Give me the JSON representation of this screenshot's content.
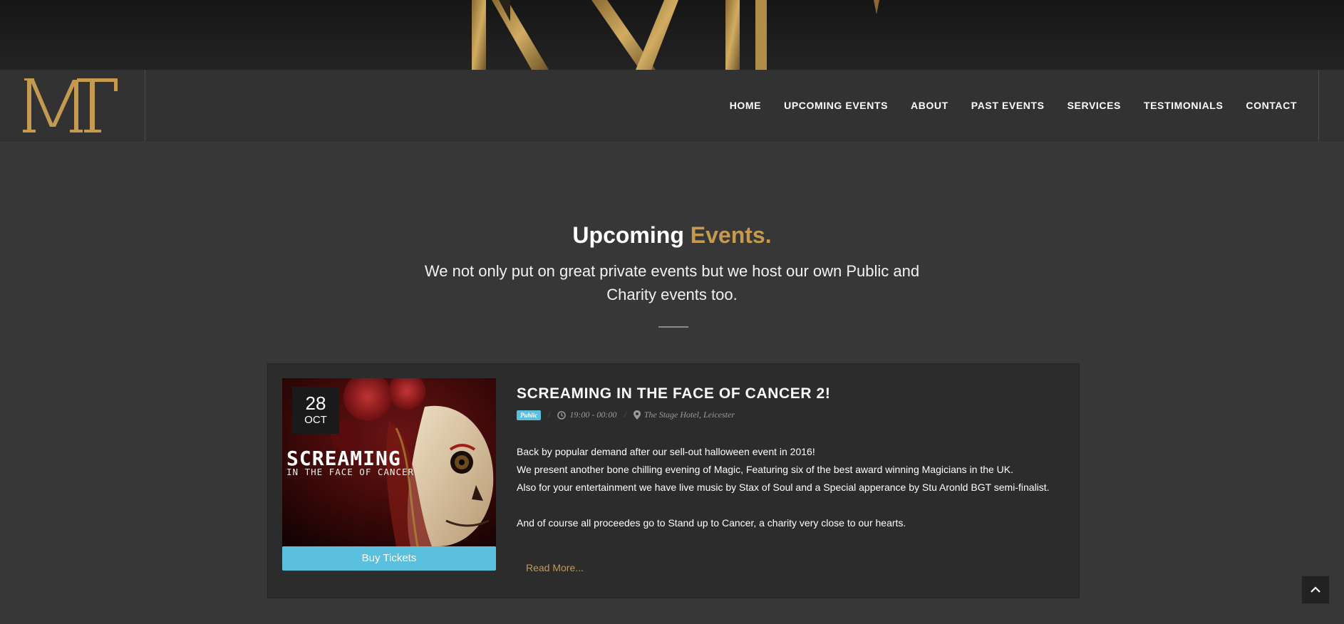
{
  "brand": {
    "logo_text": "MT",
    "accent_color": "#c39a4f"
  },
  "nav": {
    "items": [
      {
        "label": "HOME"
      },
      {
        "label": "UPCOMING EVENTS"
      },
      {
        "label": "ABOUT"
      },
      {
        "label": "PAST EVENTS"
      },
      {
        "label": "SERVICES"
      },
      {
        "label": "TESTIMONIALS"
      },
      {
        "label": "CONTACT"
      }
    ]
  },
  "section": {
    "title_part1": "Upcoming",
    "title_part2": "Events.",
    "subtitle": "We not only put on great private events but we host our own Public and Charity events too."
  },
  "event": {
    "date_day": "28",
    "date_month": "OCT",
    "poster_title": "SCREAMING",
    "poster_subtitle": "IN THE FACE OF CANCER",
    "buy_label": "Buy Tickets",
    "title": "SCREAMING IN THE FACE OF CANCER 2!",
    "tag": "Public",
    "time": "19:00 - 00:00",
    "location": "The Stage Hotel, Leicester",
    "description_lines": [
      "Back by popular demand after our sell-out halloween event in 2016!",
      "We present another bone chilling evening of Magic, Featuring six of the best award winning Magicians in the UK.",
      "Also for your entertainment we have live music by Stax of Soul and a Special apperance by Stu Aronld BGT semi-finalist.",
      "And of course all proceedes go to Stand up to Cancer, a charity very close to our hearts."
    ],
    "read_more": "Read More...",
    "tag_color": "#5bc0de"
  }
}
